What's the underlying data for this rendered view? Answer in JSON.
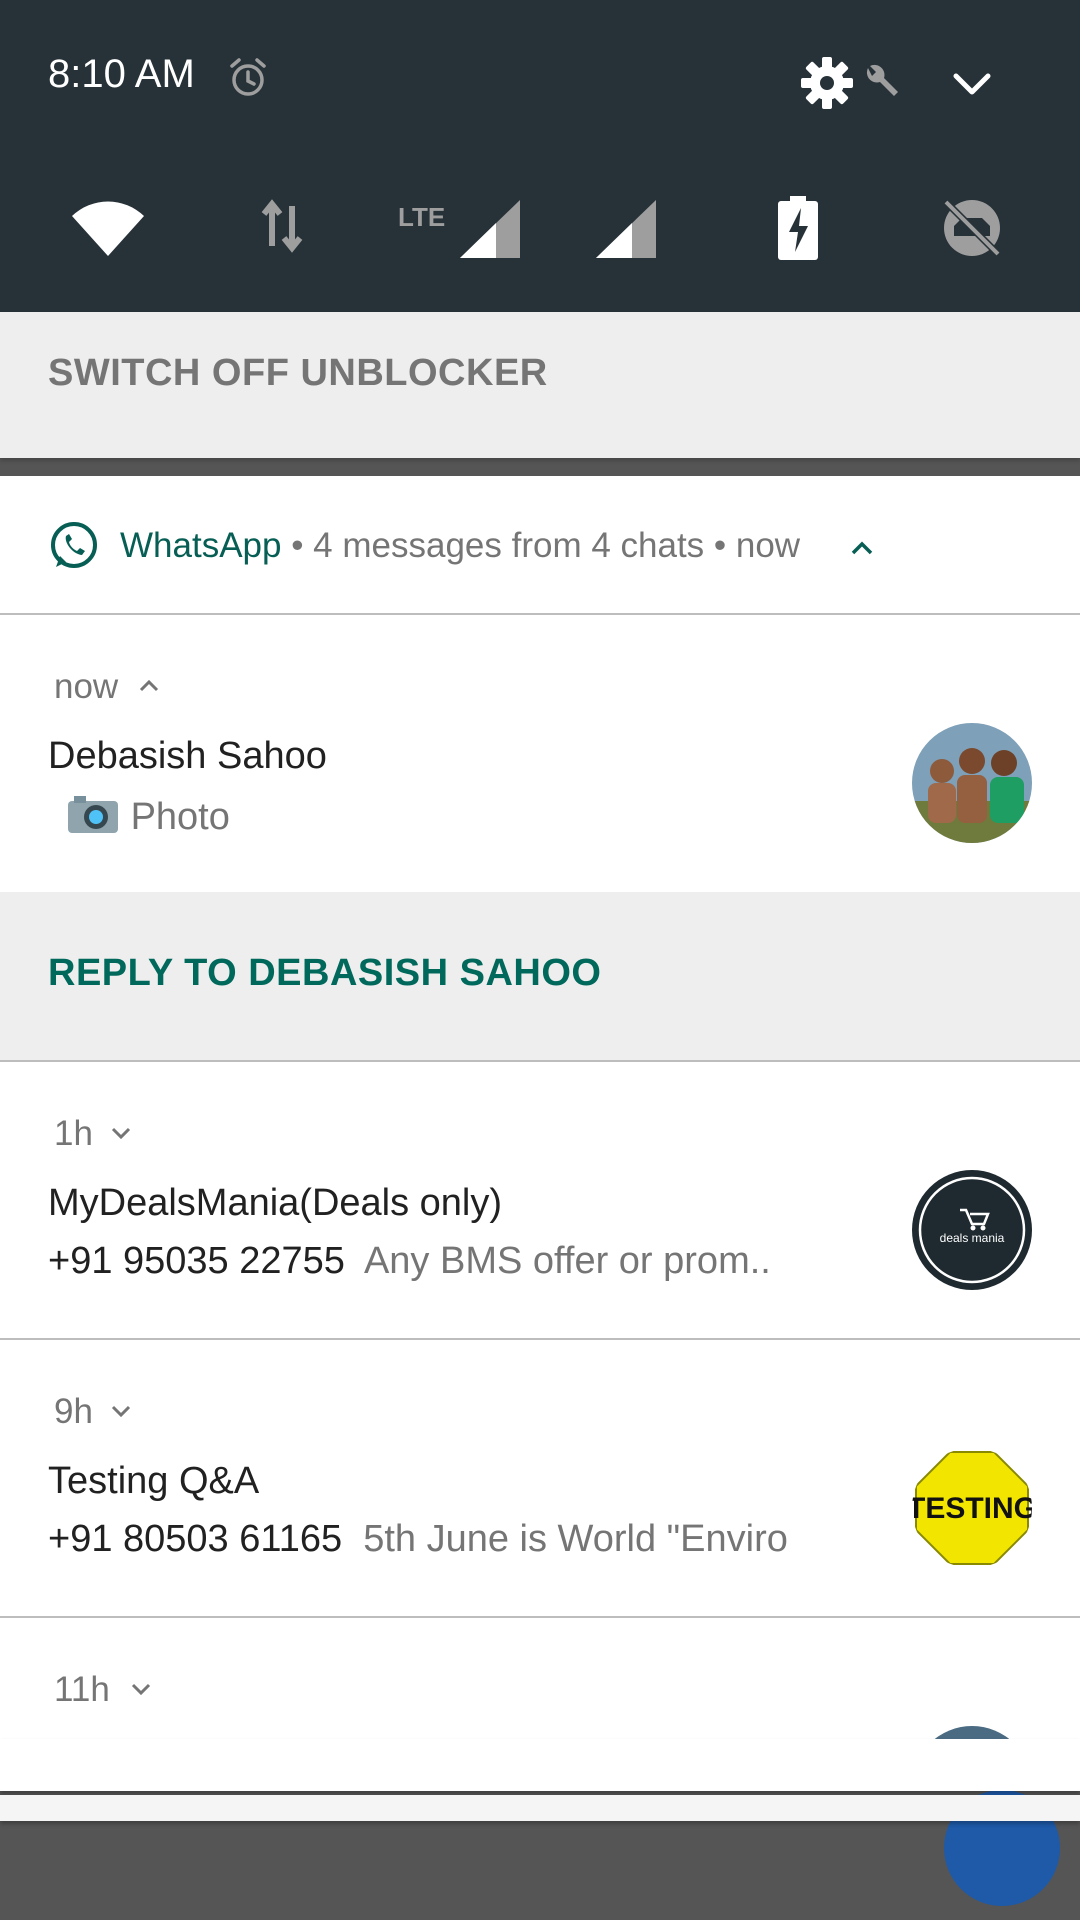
{
  "status": {
    "time": "8:10 AM",
    "icons": [
      "alarm-icon",
      "gear-icon",
      "wrench-icon",
      "chevron-down-icon"
    ]
  },
  "quick_tiles": [
    {
      "name": "wifi-icon"
    },
    {
      "name": "data-transfer-icon"
    },
    {
      "name": "lte-signal-icon",
      "label": "LTE"
    },
    {
      "name": "cell-signal-icon"
    },
    {
      "name": "battery-charging-icon"
    },
    {
      "name": "sync-off-icon"
    }
  ],
  "unblocker": {
    "label": "SWITCH OFF UNBLOCKER"
  },
  "whatsapp": {
    "app_name": "WhatsApp",
    "summary": " • 4 messages from 4 chats • now",
    "accent": "#075e54",
    "messages": [
      {
        "time": "now",
        "title": "Debasish Sahoo",
        "preview_icon": "camera-icon",
        "preview": "Photo",
        "reply_label": "REPLY TO DEBASISH SAHOO",
        "avatar": "group-photo-avatar"
      },
      {
        "time": "1h",
        "title": "MyDealsMania(Deals only)",
        "sender": "+91 95035 22755",
        "preview": "Any BMS offer or prom..",
        "avatar": "deals-mania-avatar",
        "avatar_text": "deals mania"
      },
      {
        "time": "9h",
        "title": "Testing Q&A",
        "sender": "+91 80503 61165",
        "preview": "5th June is World \"Enviro",
        "avatar": "testing-avatar",
        "avatar_text": "TESTING"
      },
      {
        "time": "11h"
      }
    ]
  },
  "colors": {
    "header_bg": "#263238",
    "reply_color": "#00695c",
    "scrim": "#555555"
  }
}
